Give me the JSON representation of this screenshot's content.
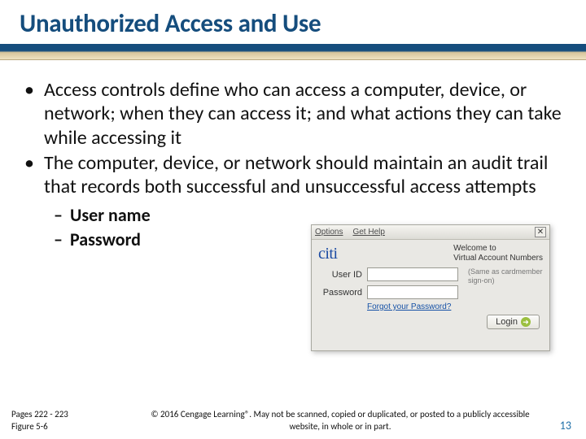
{
  "title": "Unauthorized Access and Use",
  "bullets": [
    "Access controls define who can access a computer, device, or network; when they can access it; and what actions they can take while accessing it",
    "The computer, device, or network should maintain an audit trail  that records both successful and unsuccessful access attempts"
  ],
  "subbullets": [
    "User name",
    "Password"
  ],
  "pages_line1": "Pages 222 - 223",
  "pages_line2": "Figure 5-6",
  "copyright": "© 2016 Cengage Learning®. May not be scanned, copied or duplicated, or posted to a publicly accessible website, in whole or in part.",
  "page_number": "13",
  "login": {
    "options": "Options",
    "gethelp": "Get Help",
    "close": "✕",
    "brand_text": "citi",
    "welcome_line1": "Welcome to",
    "welcome_line2": "Virtual Account Numbers",
    "userid_label": "User ID",
    "password_label": "Password",
    "sidenote": "(Same as cardmember sign-on)",
    "forgot": "Forgot your Password?",
    "login_btn": "Login",
    "arrow": "➜"
  }
}
